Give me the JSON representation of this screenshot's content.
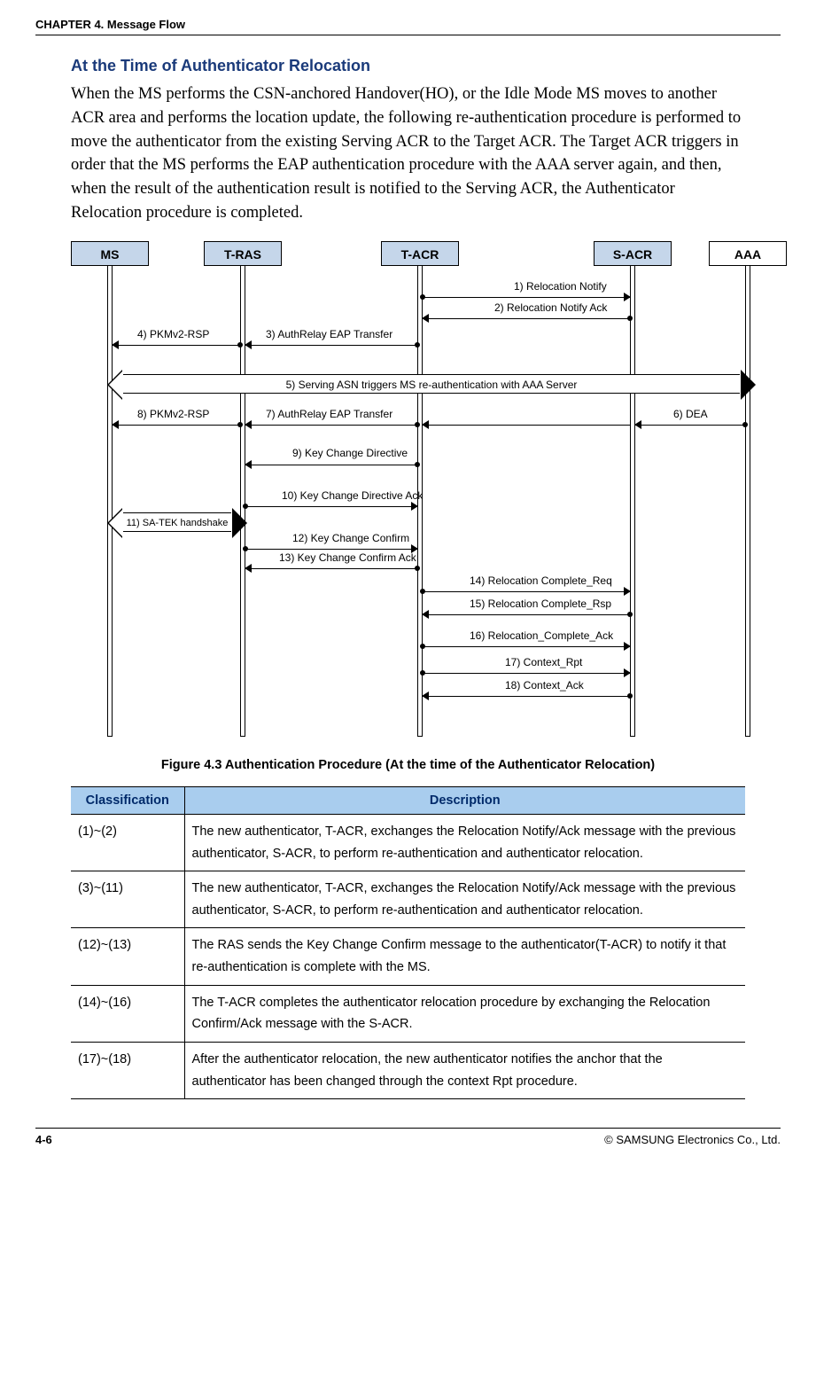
{
  "header": {
    "chapter": "CHAPTER 4. Message Flow"
  },
  "section": {
    "title": "At the Time of Authenticator Relocation"
  },
  "paragraph": "When the MS performs the CSN-anchored Handover(HO), or the Idle Mode MS moves to another ACR area and performs the location update, the following re-authentication procedure is performed to move the authenticator from the existing Serving ACR to the Target ACR. The Target ACR triggers in order that the MS performs the EAP authentication procedure with the AAA server again, and then, when the result of the authentication result is notified to the Serving ACR, the Authenticator Relocation procedure is completed.",
  "diagram": {
    "nodes": {
      "ms": "MS",
      "tras": "T-RAS",
      "tacr": "T-ACR",
      "sacr": "S-ACR",
      "aaa": "AAA"
    },
    "msgs": {
      "m1": "1) Relocation Notify",
      "m2": "2) Relocation Notify Ack",
      "m3": "3) AuthRelay EAP Transfer",
      "m4": "4) PKMv2-RSP",
      "m5": "5) Serving ASN triggers MS re-authentication with AAA Server",
      "m6": "6) DEA",
      "m7": "7) AuthRelay EAP Transfer",
      "m8": "8) PKMv2-RSP",
      "m9": "9) Key Change Directive",
      "m10": "10) Key Change Directive Ack",
      "m11": "11) SA-TEK handshake",
      "m12": "12) Key Change Confirm",
      "m13": "13) Key Change Confirm Ack",
      "m14": "14) Relocation Complete_Req",
      "m15": "15) Relocation Complete_Rsp",
      "m16": "16) Relocation_Complete_Ack",
      "m17": "17) Context_Rpt",
      "m18": "18) Context_Ack"
    }
  },
  "figure_caption": "Figure 4.3    Authentication Procedure (At the time of the Authenticator Relocation)",
  "table": {
    "head": {
      "c1": "Classification",
      "c2": "Description"
    },
    "rows": [
      {
        "c1": "(1)~(2)",
        "c2": "The new authenticator, T-ACR, exchanges the Relocation Notify/Ack message with the previous authenticator, S-ACR, to perform re-authentication and authenticator relocation."
      },
      {
        "c1": "(3)~(11)",
        "c2": "The new authenticator, T-ACR, exchanges the Relocation Notify/Ack message with the previous authenticator, S-ACR, to perform re-authentication and authenticator relocation."
      },
      {
        "c1": "(12)~(13)",
        "c2": "The RAS sends the Key Change Confirm message to the authenticator(T-ACR) to notify it that re-authentication is complete with the MS."
      },
      {
        "c1": "(14)~(16)",
        "c2": "The T-ACR completes the authenticator relocation procedure by exchanging the Relocation Confirm/Ack message with the S-ACR."
      },
      {
        "c1": "(17)~(18)",
        "c2": "After the authenticator relocation, the new authenticator notifies the anchor that the authenticator has been changed through the context Rpt procedure."
      }
    ]
  },
  "footer": {
    "page": "4-6",
    "copyright": "© SAMSUNG Electronics Co., Ltd."
  }
}
